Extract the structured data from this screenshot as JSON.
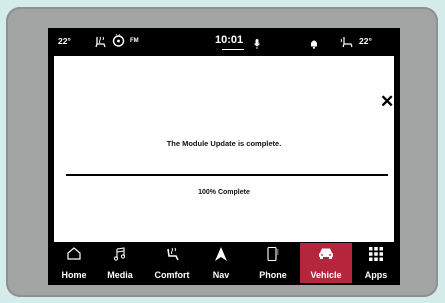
{
  "status_bar": {
    "left_temp": "22°",
    "radio_band": "FM",
    "clock": "10:01",
    "right_temp": "22°"
  },
  "dialog": {
    "message": "The Module Update is complete.",
    "progress_text": "100% Complete",
    "progress_fraction": 1.0
  },
  "nav": {
    "items": [
      {
        "label": "Home",
        "icon": "home-icon",
        "active": false
      },
      {
        "label": "Media",
        "icon": "music-note-icon",
        "active": false
      },
      {
        "label": "Comfort",
        "icon": "seat-heat-icon",
        "active": false
      },
      {
        "label": "Nav",
        "icon": "navigation-arrow-icon",
        "active": false
      },
      {
        "label": "Phone",
        "icon": "phone-icon",
        "active": false
      },
      {
        "label": "Vehicle",
        "icon": "car-icon",
        "active": true
      },
      {
        "label": "Apps",
        "icon": "apps-grid-icon",
        "active": false
      }
    ]
  },
  "colors": {
    "active_tab": "#b5253b",
    "bezel": "#a3a4a4",
    "background": "#d4ecec"
  }
}
